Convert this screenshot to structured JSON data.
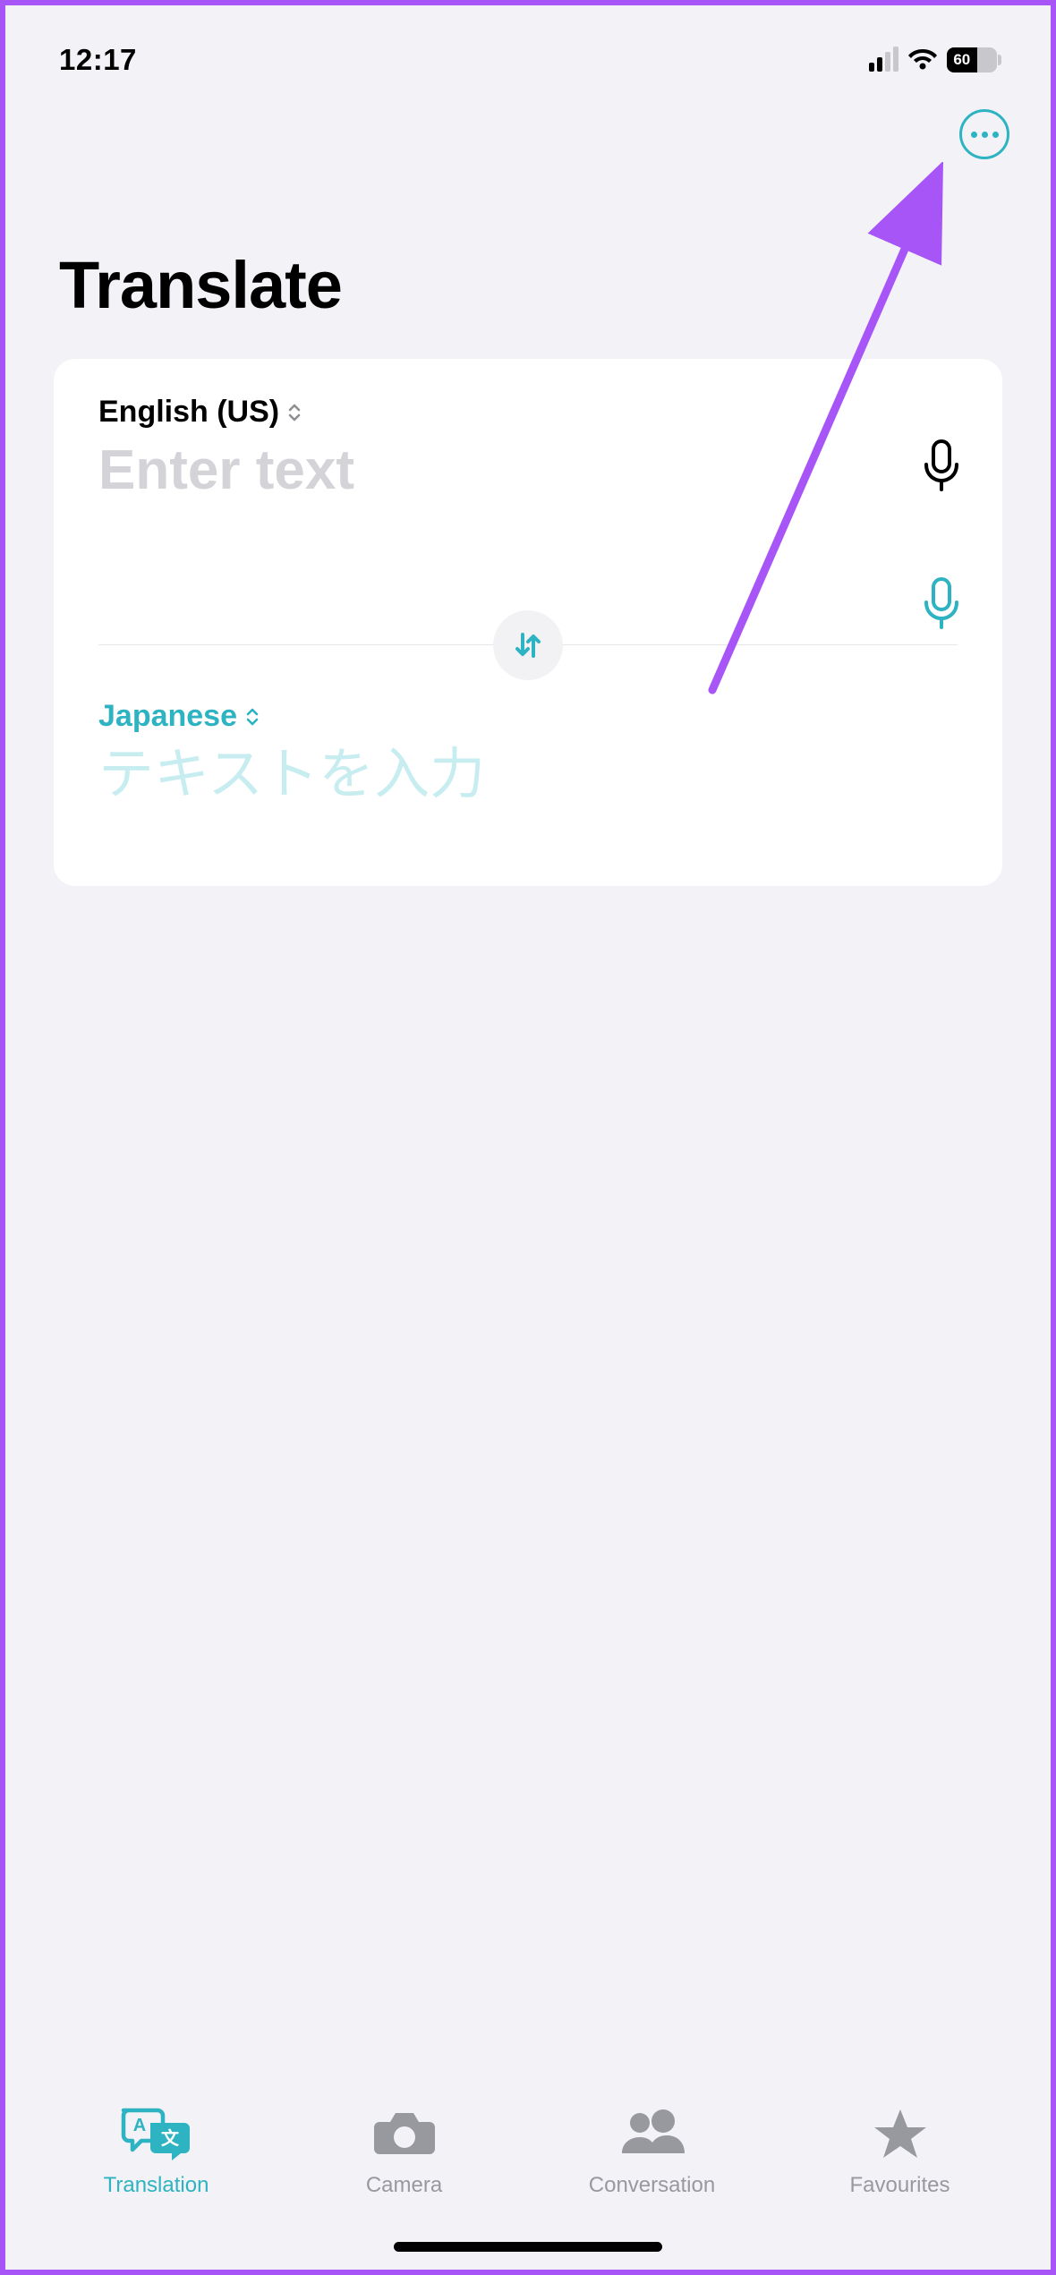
{
  "status": {
    "time": "12:17",
    "battery_percent": "60",
    "battery_fill_pct": 60
  },
  "header": {
    "title": "Translate"
  },
  "card": {
    "source": {
      "language": "English (US)",
      "placeholder": "Enter text"
    },
    "target": {
      "language": "Japanese",
      "placeholder": "テキストを入力"
    }
  },
  "tabs": {
    "translation": "Translation",
    "camera": "Camera",
    "conversation": "Conversation",
    "favourites": "Favourites"
  },
  "colors": {
    "accent": "#2db3c1",
    "annotation": "#a855f7",
    "inactive": "#98989f"
  }
}
